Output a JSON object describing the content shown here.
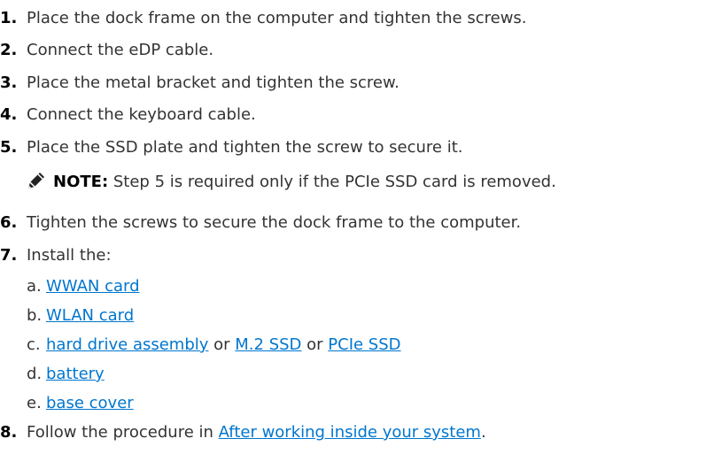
{
  "steps": [
    {
      "num": "1.",
      "text": "Place the dock frame on the computer and tighten the screws."
    },
    {
      "num": "2.",
      "text": "Connect the eDP cable."
    },
    {
      "num": "3.",
      "text": "Place the metal bracket and tighten the screw."
    },
    {
      "num": "4.",
      "text": "Connect the keyboard cable."
    },
    {
      "num": "5.",
      "text": "Place the SSD plate and tighten the screw to secure it."
    },
    {
      "num": "6.",
      "text": "Tighten the screws to secure the dock frame to the computer."
    },
    {
      "num": "7.",
      "text": "Install the:"
    },
    {
      "num": "8.",
      "text_before": "Follow the procedure in ",
      "link": "After working inside your system",
      "text_after": "."
    }
  ],
  "note": {
    "icon": "pencil-note-icon",
    "label": "NOTE:",
    "text": " Step 5 is required only if the PCIe SSD card is removed."
  },
  "install_items": [
    {
      "letter": "a.",
      "link": "WWAN card"
    },
    {
      "letter": "b.",
      "link": "WLAN card"
    },
    {
      "letter": "c.",
      "link1": "hard drive assembly",
      "sep1": " or ",
      "link2": "M.2 SSD",
      "sep2": " or ",
      "link3": "PCIe SSD"
    },
    {
      "letter": "d.",
      "link": "battery"
    },
    {
      "letter": "e.",
      "link": "base cover"
    }
  ],
  "colors": {
    "link": "#0076ce",
    "text": "#333333"
  }
}
